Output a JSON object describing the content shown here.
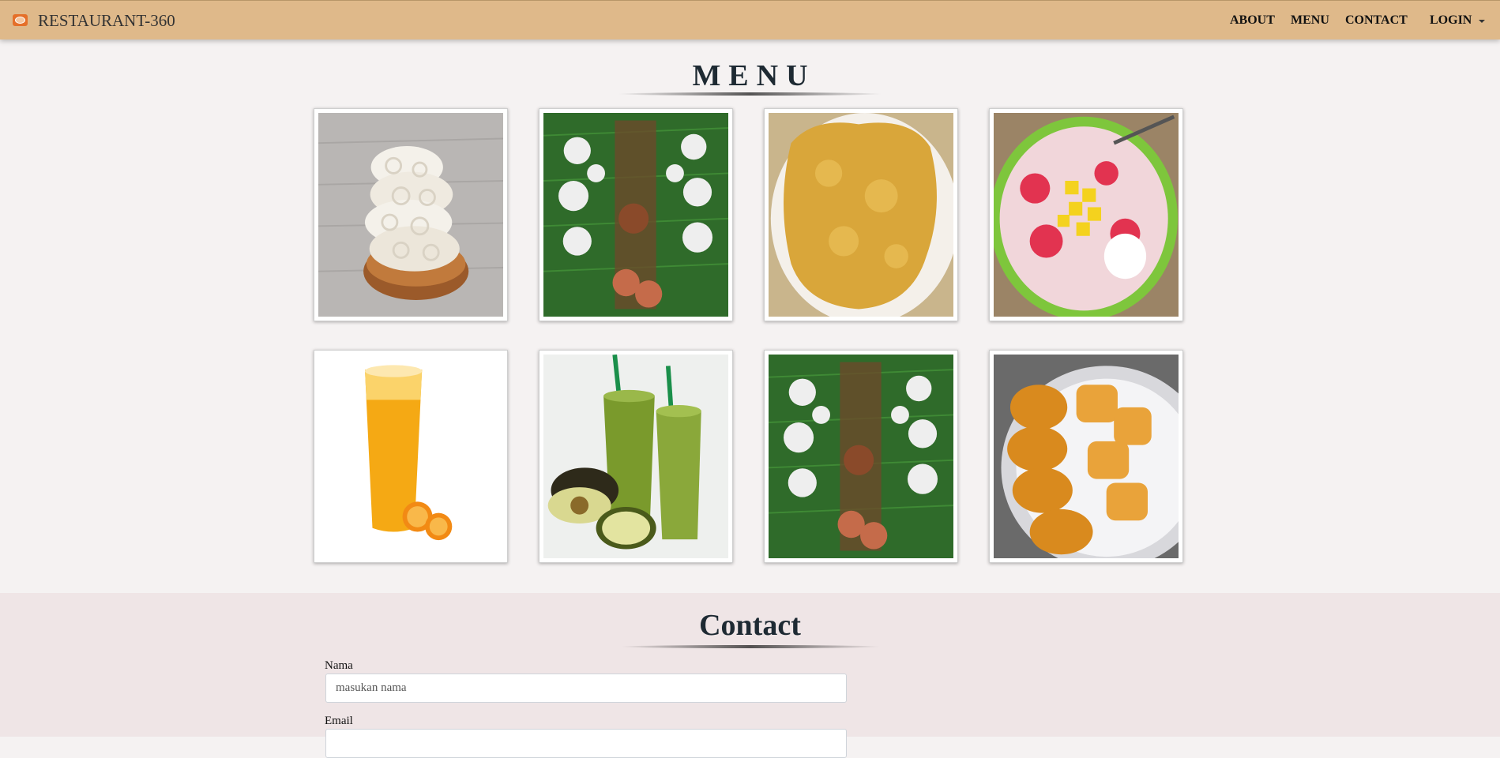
{
  "navbar": {
    "brand": "RESTAURANT-360",
    "links": [
      "ABOUT",
      "MENU",
      "CONTACT"
    ],
    "login": "LOGIN"
  },
  "menu": {
    "title": "MENU",
    "items": [
      {
        "image": "kerupuk-crackers"
      },
      {
        "image": "nasi-liwet-banana-leaf-feast"
      },
      {
        "image": "omelette"
      },
      {
        "image": "es-campur-shaved-ice"
      },
      {
        "image": "orange-juice"
      },
      {
        "image": "avocado-juice"
      },
      {
        "image": "nasi-liwet-banana-leaf-feast"
      },
      {
        "image": "tempe-and-tofu"
      }
    ]
  },
  "contact": {
    "title": "Contact",
    "name_label": "Nama",
    "name_placeholder": "masukan nama",
    "email_label": "Email"
  },
  "colors": {
    "navbar_bg": "#dfb98a",
    "page_bg": "#f5f2f2",
    "contact_bg": "#efe5e6"
  }
}
